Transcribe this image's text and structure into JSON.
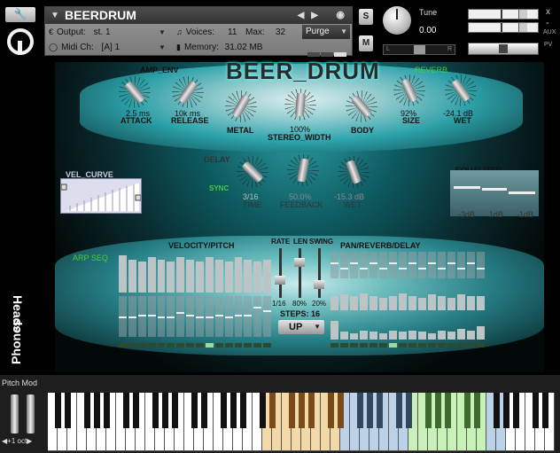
{
  "header": {
    "instrument_name": "BEERDRUM",
    "output_label": "Output:",
    "output_value": "st. 1",
    "midi_label": "Midi Ch:",
    "midi_value": "[A]  1",
    "voices_label": "Voices:",
    "voices_value": "11",
    "max_label": "Max:",
    "max_value": "32",
    "memory_label": "Memory:",
    "memory_value": "31.02 MB",
    "purge_label": "Purge",
    "solo_label": "S",
    "mute_label": "M",
    "tune_label": "Tune",
    "tune_value": "0.00",
    "pan_left": "L",
    "pan_right": "R",
    "aux_label": "AUX",
    "pv_label": "PV",
    "close_label": "x",
    "minus_label": "-"
  },
  "instrument": {
    "title": "BEER_DRUM",
    "amp_env_label": "AMP_ENV",
    "reverb_label": "REVERB",
    "delay_label": "DELAY",
    "sync_label": "SYNC",
    "vel_curve_label": "VEL_CURVE",
    "equalizer_label": "EQUALIZER",
    "arp_seq_label": "ARP SEQ",
    "velocity_pitch_label": "VELOCITY/PITCH",
    "pan_reverb_delay_label": "PAN/REVERB/DELAY",
    "rate_label": "RATE",
    "len_label": "LEN",
    "swing_label": "SWING",
    "steps_label": "STEPS: 16",
    "rate_value": "1/16",
    "len_value": "80%",
    "swing_value": "20%",
    "direction": "UP",
    "brand_line1": "Phones",
    "brand_line2": "Heads",
    "knobs": {
      "attack": {
        "label": "ATTACK",
        "value": "2.5 ms"
      },
      "release": {
        "label": "RELEASE",
        "value": "10k ms"
      },
      "metal": {
        "label": "METAL",
        "value": ""
      },
      "stereo_width": {
        "label": "STEREO_WIDTH",
        "value": "100%"
      },
      "body": {
        "label": "BODY",
        "value": ""
      },
      "size": {
        "label": "SIZE",
        "value": "92%"
      },
      "wet": {
        "label": "WET",
        "value": "-24.1 dB"
      },
      "time": {
        "label": "TIME",
        "value": "3/16"
      },
      "feedback": {
        "label": "FEEDBACK",
        "value": "50.0%"
      },
      "delay_wet": {
        "label": "WET",
        "value": "-15.3 dB"
      }
    },
    "eq_labels": [
      "-3dB",
      "1dB",
      "-1dB"
    ],
    "velocity_bars": [
      0.95,
      0.85,
      0.8,
      0.9,
      0.85,
      0.8,
      0.9,
      0.85,
      0.8,
      0.9,
      0.85,
      0.8,
      0.9,
      0.85,
      0.8,
      0.85
    ],
    "pitch_bars": [
      0.5,
      0.5,
      0.55,
      0.55,
      0.5,
      0.5,
      0.6,
      0.55,
      0.5,
      0.5,
      0.55,
      0.5,
      0.55,
      0.55,
      0.75,
      0.65
    ],
    "pan_bars": [
      0.6,
      0.4,
      0.6,
      0.4,
      0.6,
      0.4,
      0.6,
      0.4,
      0.6,
      0.4,
      0.6,
      0.4,
      0.6,
      0.4,
      0.6,
      0.4
    ],
    "reverb_bars": [
      0.5,
      0.55,
      0.5,
      0.6,
      0.5,
      0.45,
      0.5,
      0.6,
      0.5,
      0.45,
      0.55,
      0.5,
      0.45,
      0.55,
      0.5,
      0.5
    ],
    "delay_bars": [
      0.7,
      0.3,
      0.25,
      0.35,
      0.3,
      0.25,
      0.35,
      0.3,
      0.35,
      0.3,
      0.25,
      0.35,
      0.3,
      0.4,
      0.35,
      0.5
    ],
    "active_step": 4
  },
  "keyboard": {
    "pitch_mod_label": "Pitch Mod",
    "octave_label": "+1 oct"
  }
}
